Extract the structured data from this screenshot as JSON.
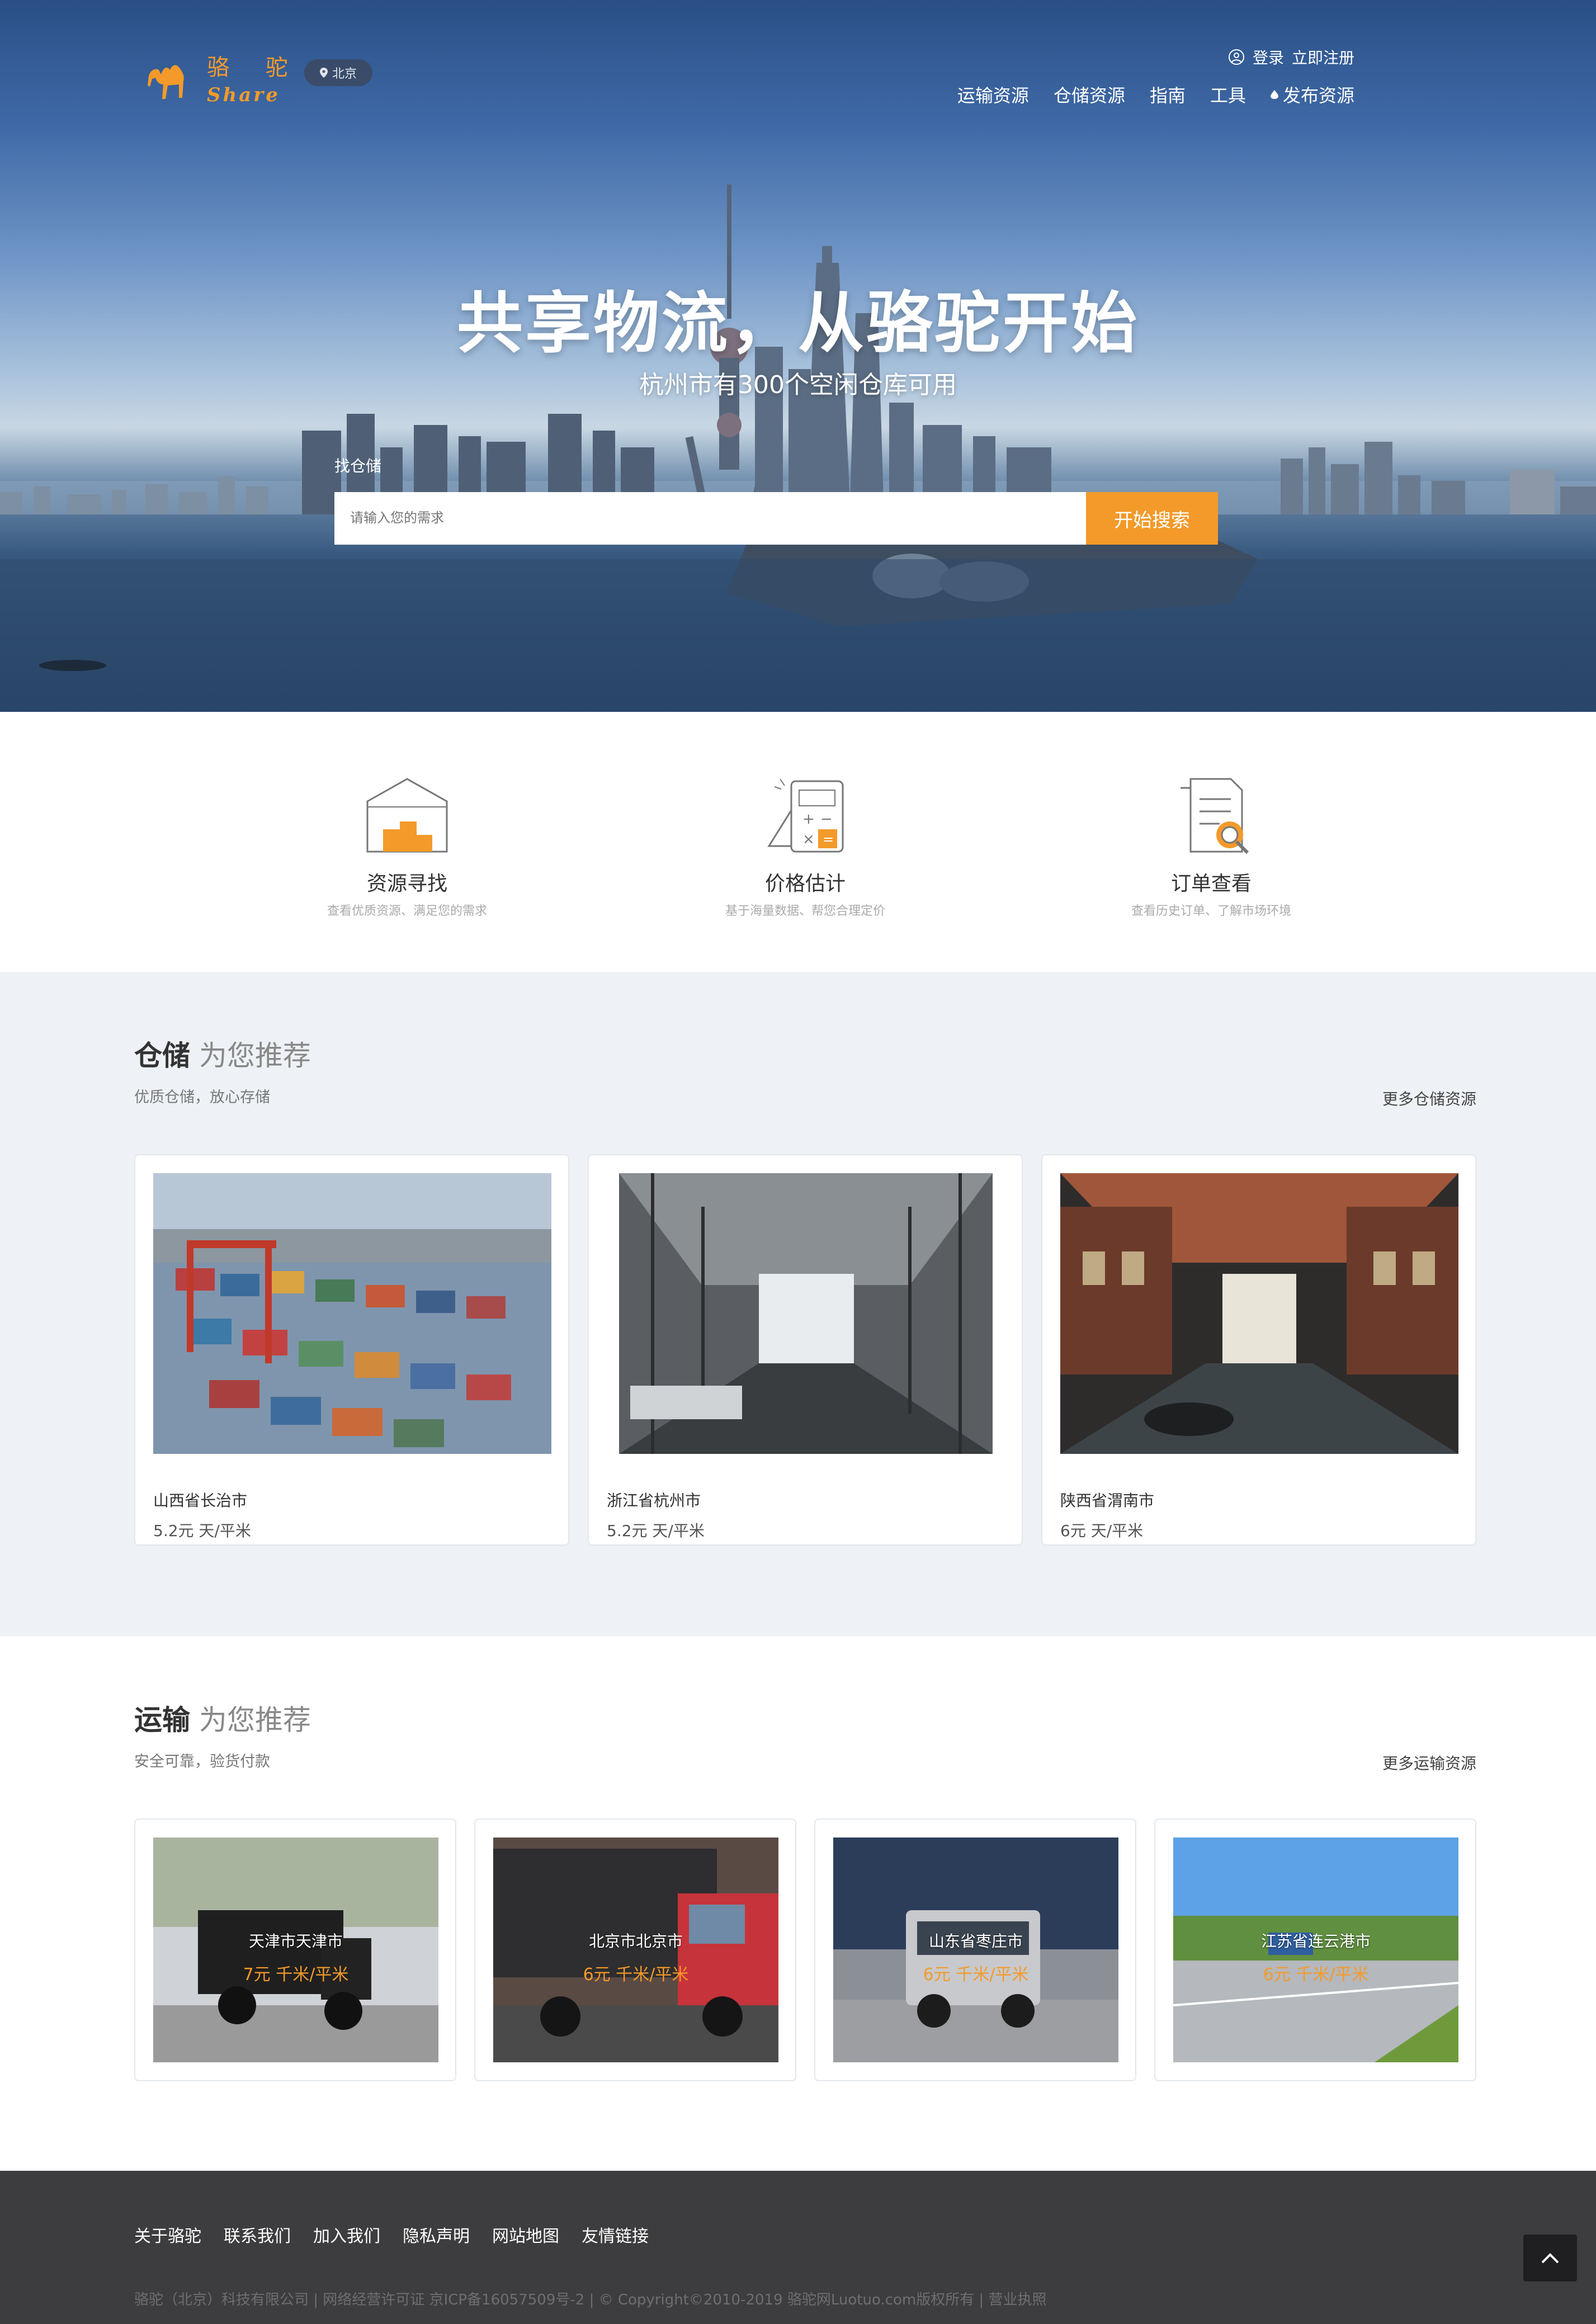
{
  "header": {
    "logo_cn": "骆 驼",
    "logo_en": "Share",
    "city": "北京",
    "login": "登录",
    "register": "立即注册",
    "nav": [
      "运输资源",
      "仓储资源",
      "指南",
      "工具"
    ],
    "publish": "发布资源"
  },
  "hero": {
    "title": "共享物流，从骆驼开始",
    "subtitle": "杭州市有300个空闲仓库可用",
    "search_tab": "找仓储",
    "search_placeholder": "请输入您的需求",
    "search_button": "开始搜索"
  },
  "features": [
    {
      "title": "资源寻找",
      "desc": "查看优质资源、满足您的需求",
      "icon": "warehouse-icon"
    },
    {
      "title": "价格估计",
      "desc": "基于海量数据、帮您合理定价",
      "icon": "calculator-icon"
    },
    {
      "title": "订单查看",
      "desc": "查看历史订单、了解市场环境",
      "icon": "order-search-icon"
    }
  ],
  "warehouse": {
    "title": "仓储",
    "title_suffix": "为您推荐",
    "desc": "优质仓储，放心存储",
    "more": "更多仓储资源",
    "items": [
      {
        "location": "山西省长治市",
        "price": "5.2元 天/平米"
      },
      {
        "location": "浙江省杭州市",
        "price": "5.2元 天/平米"
      },
      {
        "location": "陕西省渭南市",
        "price": "6元 天/平米"
      }
    ]
  },
  "transport": {
    "title": "运输",
    "title_suffix": "为您推荐",
    "desc": "安全可靠，验货付款",
    "more": "更多运输资源",
    "items": [
      {
        "location": "天津市天津市",
        "price": "7元 千米/平米"
      },
      {
        "location": "北京市北京市",
        "price": "6元 千米/平米"
      },
      {
        "location": "山东省枣庄市",
        "price": "6元 千米/平米"
      },
      {
        "location": "江苏省连云港市",
        "price": "6元 千米/平米"
      }
    ]
  },
  "footer": {
    "links": [
      "关于骆驼",
      "联系我们",
      "加入我们",
      "隐私声明",
      "网站地图",
      "友情链接"
    ],
    "copyright": "骆驼（北京）科技有限公司 | 网络经营许可证 京ICP备16057509号-2 | © Copyright©2010-2019 骆驼网Luotuo.com版权所有 | 营业执照"
  },
  "colors": {
    "accent": "#f39a2a",
    "footer_bg": "#3d3d3f",
    "section_bg": "#eef2f6"
  }
}
